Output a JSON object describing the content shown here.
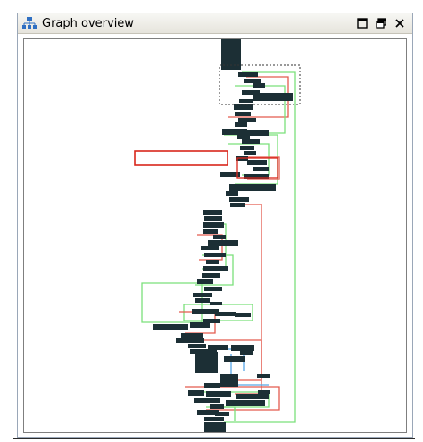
{
  "panel": {
    "title": "Graph overview",
    "icons": {
      "app": "graph-hierarchy-icon",
      "maximize": "maximize-icon",
      "restore": "restore-window-icon",
      "close": "close-icon"
    }
  },
  "colors": {
    "block_fill": "#1c2f35",
    "edge_true": "#7be07b",
    "edge_false": "#e35b4e",
    "edge_uncond": "#56a6e8",
    "selected": "#d8261b",
    "viewport": "#333333"
  }
}
